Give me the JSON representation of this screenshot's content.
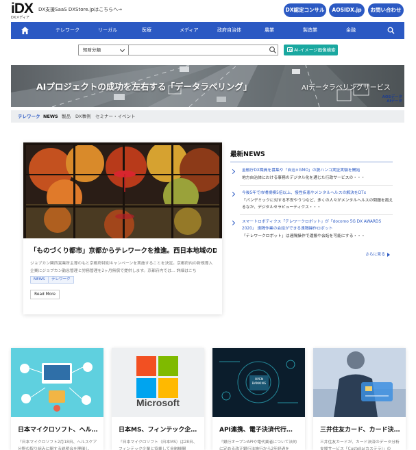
{
  "header": {
    "logo_main": "iDX",
    "logo_sub": "DXメディア",
    "tagline": "DX支援SaaS DXStore.jpはこちらへ→",
    "buttons": [
      "DX認定コンサル",
      "AOSIDX.jp",
      "お問い合わせ"
    ]
  },
  "nav": {
    "items": [
      "テレワーク",
      "リーガル",
      "医療",
      "メディア",
      "政府自治体",
      "農業",
      "製造業",
      "金融"
    ]
  },
  "search": {
    "category_label": "知財分類",
    "placeholder": "",
    "ai_button": "AI-イメージ画像検索"
  },
  "banner": {
    "title": "AIプロジェクトの成功を左右する「データラベリング」",
    "service": "AIデータラベリングサービス",
    "brand_line1": "AOSデータ",
    "brand_line2": "AIデータ"
  },
  "subnav": {
    "items": [
      "テレワーク",
      "NEWS",
      "製品",
      "DX事例",
      "セミナー・イベント"
    ]
  },
  "feature": {
    "title": "「ものづくり都市」京都からテレワークを推進。西日本地域のDXを…",
    "excerpt": "ジョブカン関西営業所主導のもと京都府特別キャンペーンを実施することを決定。京都府内の新規導入企業にジョブカン勤怠管理と労務管理を2ヶ月無償で提供します。京都府内では… 詳細はこち",
    "tags": [
      "NEWS",
      "テレワーク"
    ],
    "read_more": "Read More"
  },
  "news": {
    "heading": "最新NEWS",
    "items": [
      {
        "title": "金融庁DX職員を募集や「自治×GMO」の脱ハンコ実証実験を開始",
        "sub": "地方自治体における事務のデジタル化を通じた行政サービスの・・・"
      },
      {
        "title": "今後5年で市場規模5倍以上、慢性疾患やメンタルヘルスの解決をDTx",
        "sub": "「パンデミックに対する不安やうつなど、多くの人々がメンタルヘルスの問題を抱えるなか、デジタルセラピューティクス・・・"
      },
      {
        "title": "スマートロボティクス「テレワークロボット」が「docomo 5G DX AWARDS 2020」 遠隔作業の会話ができる遠隔操作ロボット",
        "sub": "「テレワークロボット」は遠隔操作で運搬や会話を可能にする・・・"
      }
    ],
    "see_more": "さらに見る"
  },
  "cards": [
    {
      "title": "日本マイクロソフト、ヘル…",
      "excerpt": "「日本マイクロソフト2月18日、ヘルスケア分野の取り組みに関する説明会を開催し"
    },
    {
      "title": "日本MS、フィンテック企業…",
      "excerpt": "「日本マイクロソフト（日本MS）は28日、フィンテック企業と協業して金融機関"
    },
    {
      "title": "API連携、電子決済代行…",
      "excerpt": "「銀行オープンAPIや電代業者について法的に定める改正銀行法施行から2年経過を"
    },
    {
      "title": "三井住友カード、カード決…",
      "excerpt": "三井住友カードが、カード決済のデータ分析支援サービス「Custella(カステラ)」の"
    }
  ],
  "card_art": {
    "microsoft_word": "Microsoft",
    "open_banking": "OPEN BANKING"
  },
  "colors": {
    "brand_blue": "#2b59c3",
    "teal": "#1aa8a0",
    "subnav_bg": "#eceef0"
  }
}
